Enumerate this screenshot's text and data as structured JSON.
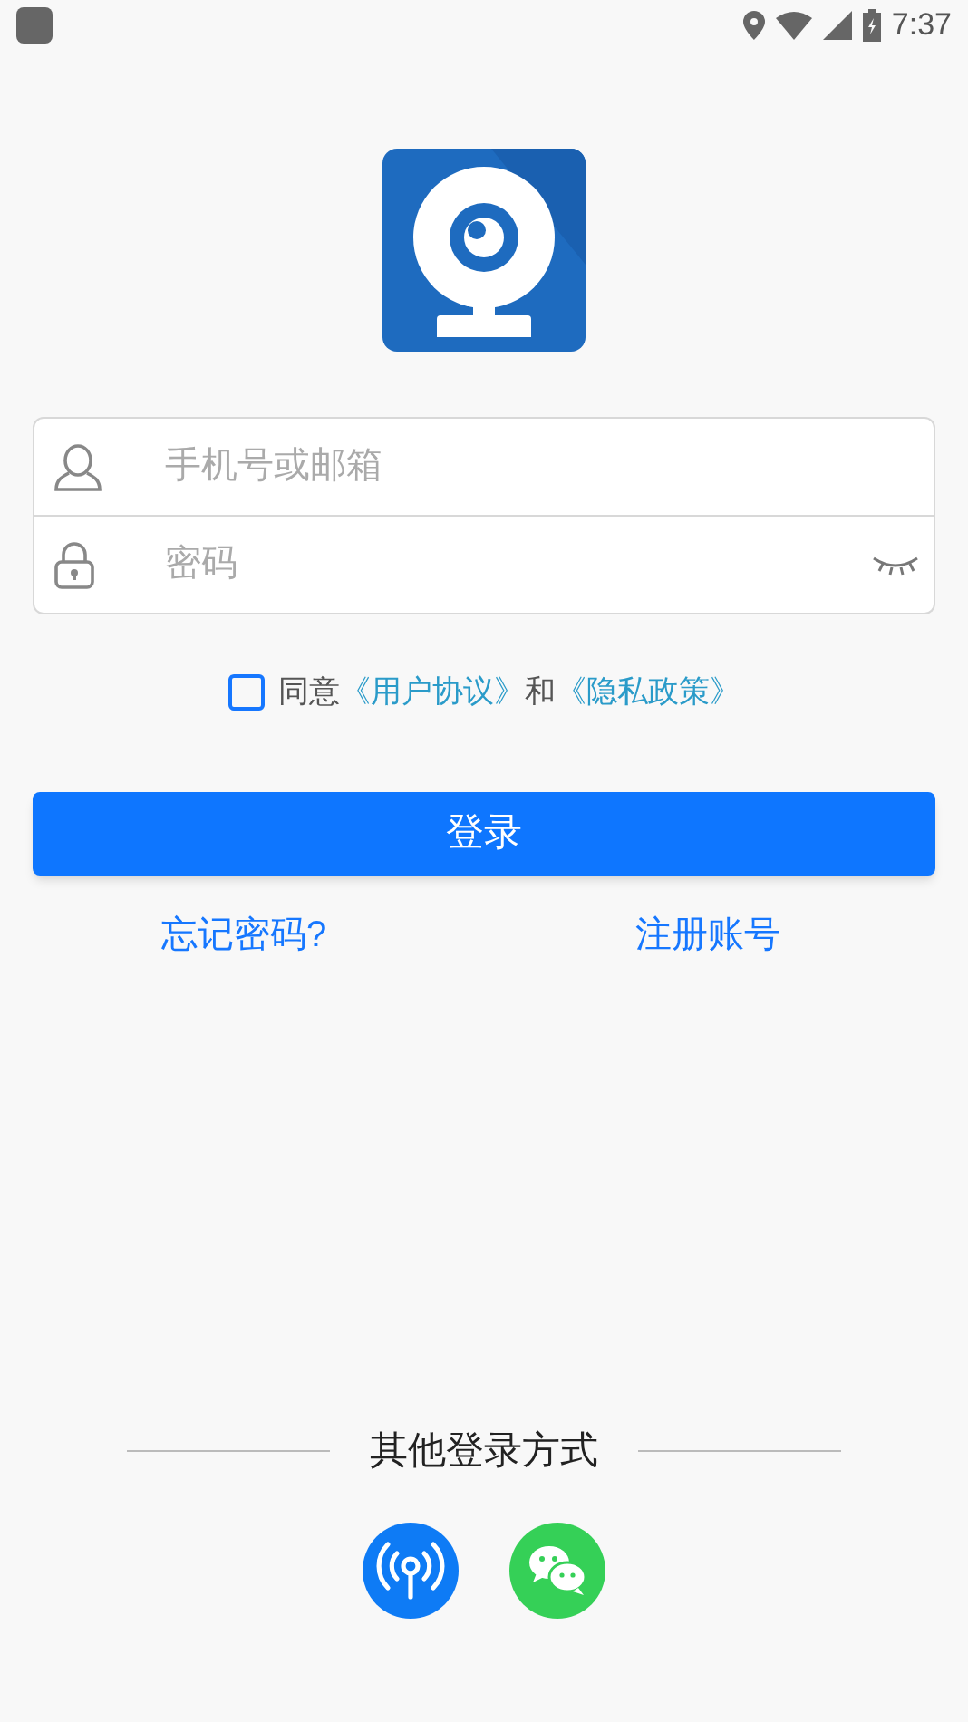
{
  "status_bar": {
    "time": "7:37"
  },
  "fields": [
    {
      "kind": "account",
      "placeholder": "手机号或邮箱"
    },
    {
      "kind": "password",
      "placeholder": "密码"
    }
  ],
  "agreement": {
    "checked": false,
    "prefix": "同意",
    "user_agreement": "《用户协议》",
    "joiner": "和",
    "privacy_policy": "《隐私政策》"
  },
  "login_button": "登录",
  "links": [
    "忘记密码?",
    "注册账号"
  ],
  "other_login": {
    "title": "其他登录方式",
    "methods": [
      {
        "kind": "hotspot"
      },
      {
        "kind": "wechat"
      }
    ]
  }
}
